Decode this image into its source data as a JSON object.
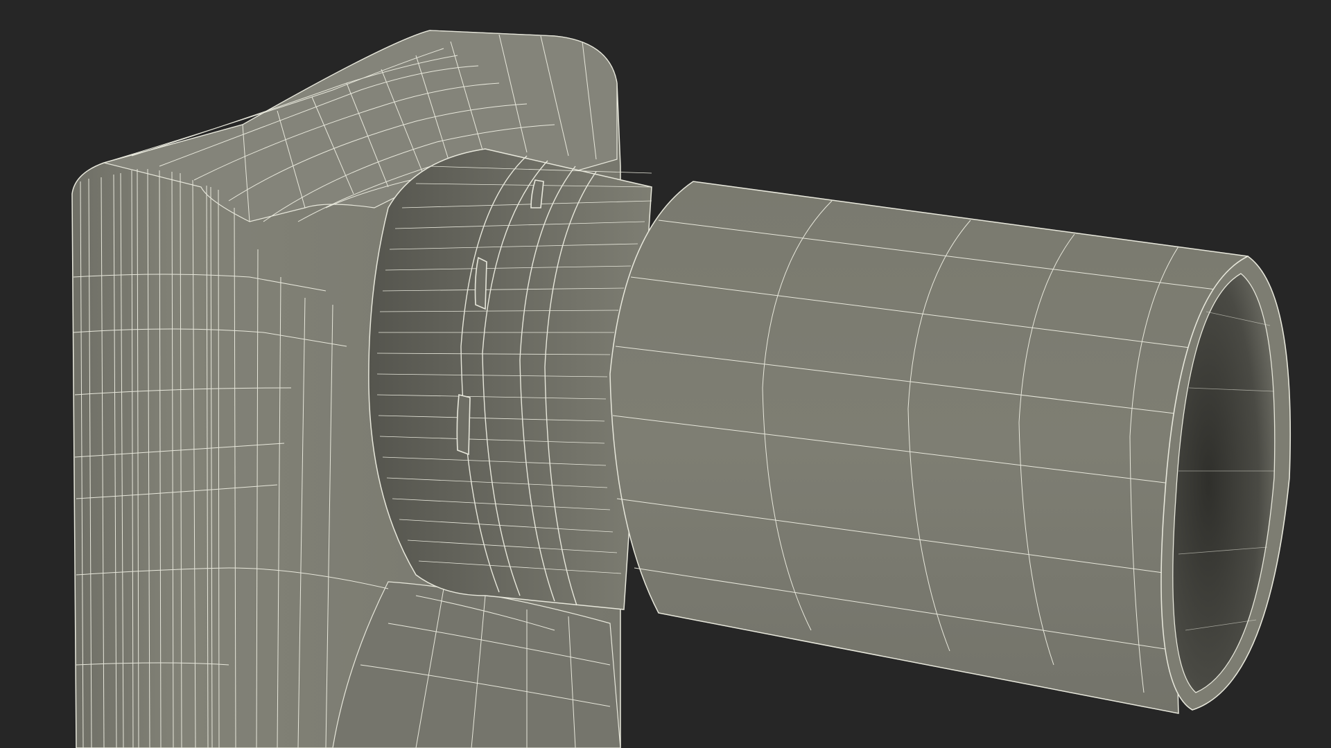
{
  "scene": {
    "subject": "wireframe-3d-model",
    "background_color": "#262626",
    "mesh_fill_color": "#7b7b70",
    "mesh_fill_dark": "#5e5e56",
    "mesh_fill_light": "#85857a",
    "wire_color": "#e8e8dc",
    "interior_color": "#3a3a35"
  }
}
